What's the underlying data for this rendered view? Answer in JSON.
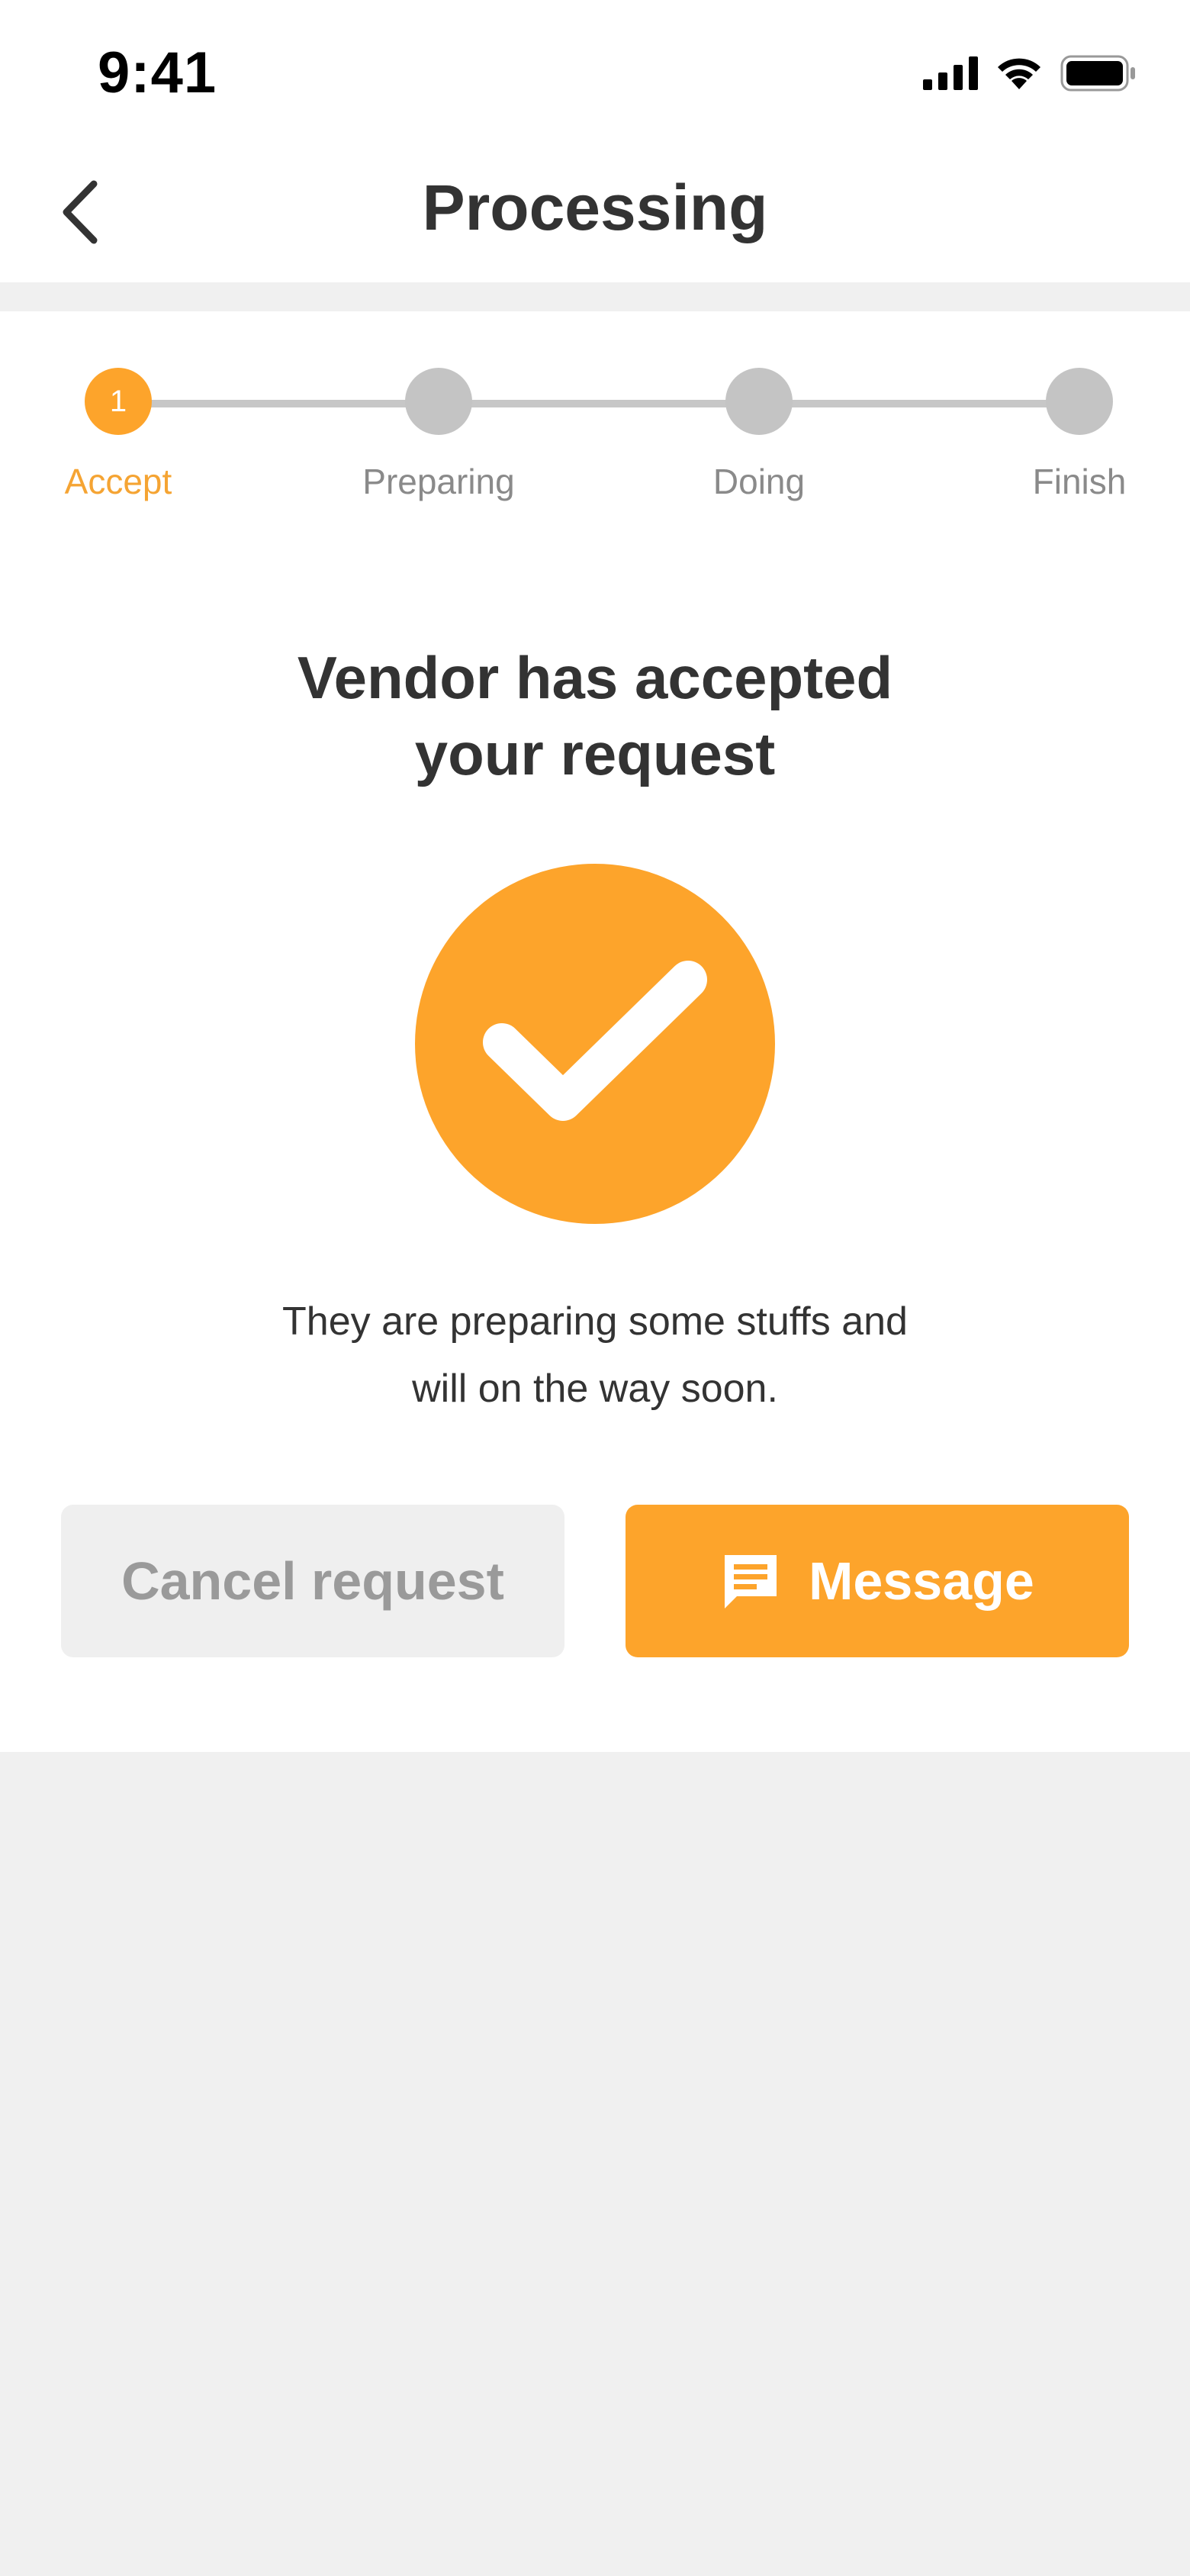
{
  "status_bar": {
    "time": "9:41",
    "icons": [
      "signal-icon",
      "wifi-icon",
      "battery-icon"
    ]
  },
  "header": {
    "title": "Processing",
    "back_icon": "chevron-left-icon"
  },
  "stepper": {
    "current_step": 1,
    "steps": [
      {
        "number": "1",
        "label": "Accept",
        "active": true
      },
      {
        "number": "",
        "label": "Preparing",
        "active": false
      },
      {
        "number": "",
        "label": "Doing",
        "active": false
      },
      {
        "number": "",
        "label": "Finish",
        "active": false
      }
    ]
  },
  "content": {
    "headline_line1": "Vendor has accepted",
    "headline_line2": "your request",
    "status_icon": "checkmark-icon",
    "description_line1": "They are preparing some stuffs and",
    "description_line2": "will on the way soon."
  },
  "actions": {
    "cancel_label": "Cancel request",
    "message_label": "Message",
    "message_icon": "chat-icon"
  },
  "colors": {
    "accent": "#FDA42B",
    "inactive": "#C4C4C4",
    "text": "#333333",
    "background": "#F0F0F0"
  }
}
